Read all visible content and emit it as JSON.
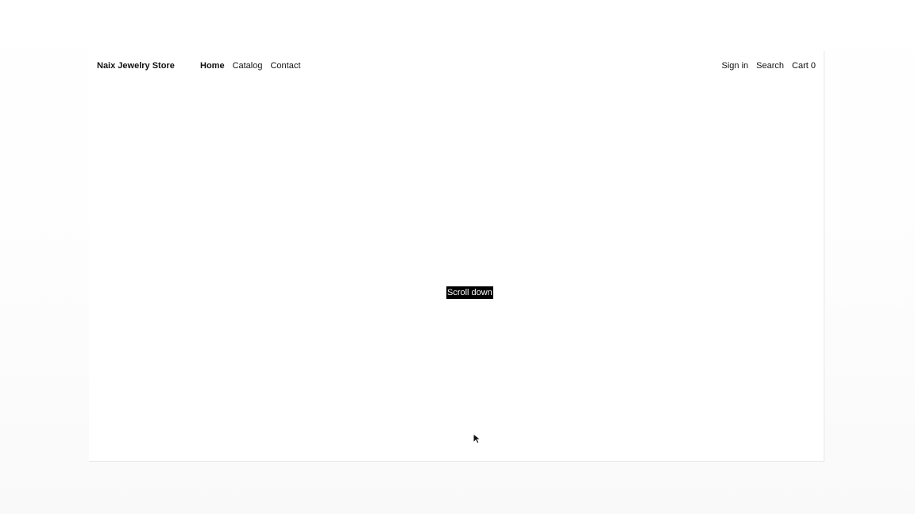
{
  "store": {
    "name": "Naix Jewelry Store"
  },
  "nav": {
    "home": "Home",
    "catalog": "Catalog",
    "contact": "Contact"
  },
  "account": {
    "sign_in": "Sign in",
    "search": "Search",
    "cart": "Cart 0"
  },
  "hero": {
    "scroll_label": "Scroll down"
  },
  "icons": {
    "cursor": "mouse-pointer-icon"
  }
}
